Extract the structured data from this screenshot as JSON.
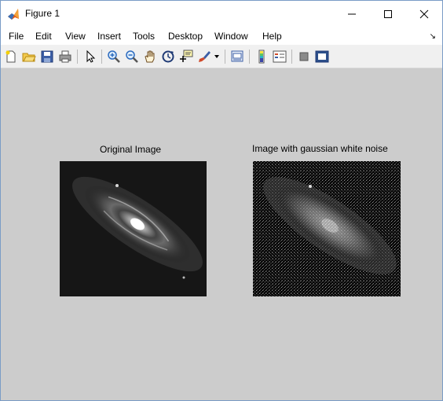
{
  "window": {
    "title": "Figure 1"
  },
  "menu": {
    "items": [
      "File",
      "Edit",
      "View",
      "Insert",
      "Tools",
      "Desktop",
      "Window",
      "Help"
    ],
    "overflow_arrow": "↘"
  },
  "toolbar": {
    "icons": [
      "new-figure-icon",
      "open-file-icon",
      "save-icon",
      "print-icon",
      "edit-plot-icon",
      "zoom-in-icon",
      "zoom-out-icon",
      "pan-icon",
      "rotate-3d-icon",
      "data-cursor-icon",
      "brush-icon",
      "brush-dropdown-icon",
      "link-plot-icon",
      "insert-colorbar-icon",
      "insert-legend-icon",
      "hide-plot-tools-icon",
      "show-plot-tools-icon"
    ]
  },
  "figure": {
    "left_axes": {
      "title": "Original Image"
    },
    "right_axes": {
      "title": "Image with gaussian white noise"
    }
  },
  "colors": {
    "canvas": "#cccccc",
    "window_border": "#7a9cc6",
    "toolbar_bg": "#f0f0f0"
  }
}
